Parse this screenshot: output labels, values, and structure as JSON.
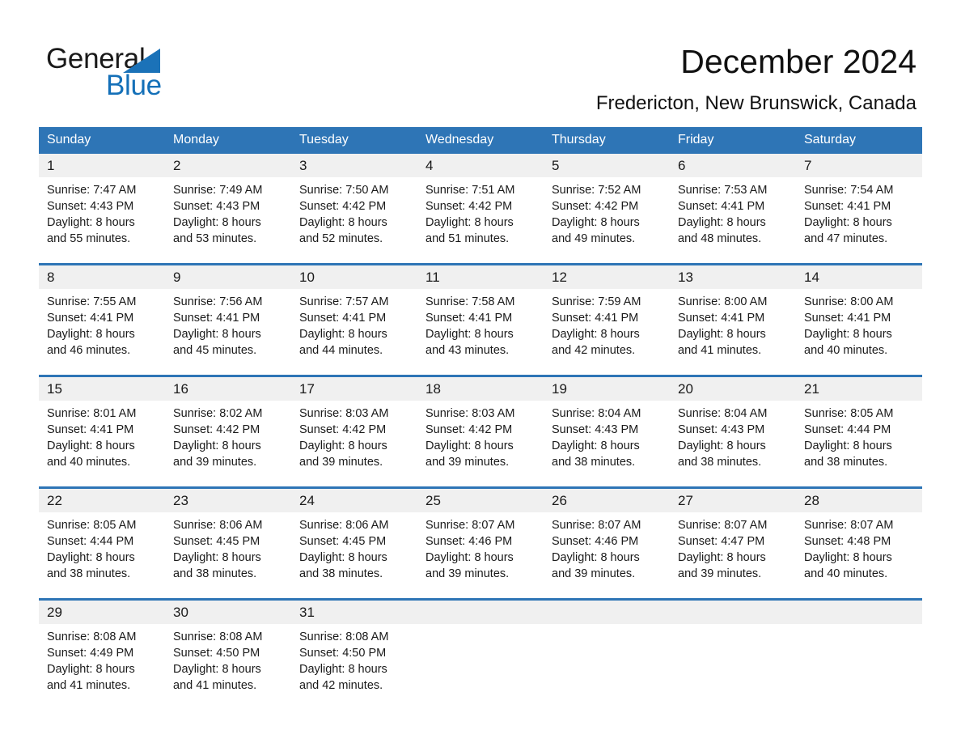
{
  "brand": {
    "name_part1": "General",
    "name_part2": "Blue",
    "triangle_color": "#1b72b8",
    "text_color_part2": "#1470b8"
  },
  "header": {
    "title": "December 2024",
    "subtitle": "Fredericton, New Brunswick, Canada"
  },
  "theme": {
    "header_blue": "#2e75b6",
    "daynum_band": "#f0f0f0",
    "text": "#1a1a1a"
  },
  "calendar": {
    "weekday_headers": [
      "Sunday",
      "Monday",
      "Tuesday",
      "Wednesday",
      "Thursday",
      "Friday",
      "Saturday"
    ],
    "weeks": [
      {
        "days": [
          {
            "num": "1",
            "sunrise": "Sunrise: 7:47 AM",
            "sunset": "Sunset: 4:43 PM",
            "daylight1": "Daylight: 8 hours",
            "daylight2": "and 55 minutes."
          },
          {
            "num": "2",
            "sunrise": "Sunrise: 7:49 AM",
            "sunset": "Sunset: 4:43 PM",
            "daylight1": "Daylight: 8 hours",
            "daylight2": "and 53 minutes."
          },
          {
            "num": "3",
            "sunrise": "Sunrise: 7:50 AM",
            "sunset": "Sunset: 4:42 PM",
            "daylight1": "Daylight: 8 hours",
            "daylight2": "and 52 minutes."
          },
          {
            "num": "4",
            "sunrise": "Sunrise: 7:51 AM",
            "sunset": "Sunset: 4:42 PM",
            "daylight1": "Daylight: 8 hours",
            "daylight2": "and 51 minutes."
          },
          {
            "num": "5",
            "sunrise": "Sunrise: 7:52 AM",
            "sunset": "Sunset: 4:42 PM",
            "daylight1": "Daylight: 8 hours",
            "daylight2": "and 49 minutes."
          },
          {
            "num": "6",
            "sunrise": "Sunrise: 7:53 AM",
            "sunset": "Sunset: 4:41 PM",
            "daylight1": "Daylight: 8 hours",
            "daylight2": "and 48 minutes."
          },
          {
            "num": "7",
            "sunrise": "Sunrise: 7:54 AM",
            "sunset": "Sunset: 4:41 PM",
            "daylight1": "Daylight: 8 hours",
            "daylight2": "and 47 minutes."
          }
        ]
      },
      {
        "days": [
          {
            "num": "8",
            "sunrise": "Sunrise: 7:55 AM",
            "sunset": "Sunset: 4:41 PM",
            "daylight1": "Daylight: 8 hours",
            "daylight2": "and 46 minutes."
          },
          {
            "num": "9",
            "sunrise": "Sunrise: 7:56 AM",
            "sunset": "Sunset: 4:41 PM",
            "daylight1": "Daylight: 8 hours",
            "daylight2": "and 45 minutes."
          },
          {
            "num": "10",
            "sunrise": "Sunrise: 7:57 AM",
            "sunset": "Sunset: 4:41 PM",
            "daylight1": "Daylight: 8 hours",
            "daylight2": "and 44 minutes."
          },
          {
            "num": "11",
            "sunrise": "Sunrise: 7:58 AM",
            "sunset": "Sunset: 4:41 PM",
            "daylight1": "Daylight: 8 hours",
            "daylight2": "and 43 minutes."
          },
          {
            "num": "12",
            "sunrise": "Sunrise: 7:59 AM",
            "sunset": "Sunset: 4:41 PM",
            "daylight1": "Daylight: 8 hours",
            "daylight2": "and 42 minutes."
          },
          {
            "num": "13",
            "sunrise": "Sunrise: 8:00 AM",
            "sunset": "Sunset: 4:41 PM",
            "daylight1": "Daylight: 8 hours",
            "daylight2": "and 41 minutes."
          },
          {
            "num": "14",
            "sunrise": "Sunrise: 8:00 AM",
            "sunset": "Sunset: 4:41 PM",
            "daylight1": "Daylight: 8 hours",
            "daylight2": "and 40 minutes."
          }
        ]
      },
      {
        "days": [
          {
            "num": "15",
            "sunrise": "Sunrise: 8:01 AM",
            "sunset": "Sunset: 4:41 PM",
            "daylight1": "Daylight: 8 hours",
            "daylight2": "and 40 minutes."
          },
          {
            "num": "16",
            "sunrise": "Sunrise: 8:02 AM",
            "sunset": "Sunset: 4:42 PM",
            "daylight1": "Daylight: 8 hours",
            "daylight2": "and 39 minutes."
          },
          {
            "num": "17",
            "sunrise": "Sunrise: 8:03 AM",
            "sunset": "Sunset: 4:42 PM",
            "daylight1": "Daylight: 8 hours",
            "daylight2": "and 39 minutes."
          },
          {
            "num": "18",
            "sunrise": "Sunrise: 8:03 AM",
            "sunset": "Sunset: 4:42 PM",
            "daylight1": "Daylight: 8 hours",
            "daylight2": "and 39 minutes."
          },
          {
            "num": "19",
            "sunrise": "Sunrise: 8:04 AM",
            "sunset": "Sunset: 4:43 PM",
            "daylight1": "Daylight: 8 hours",
            "daylight2": "and 38 minutes."
          },
          {
            "num": "20",
            "sunrise": "Sunrise: 8:04 AM",
            "sunset": "Sunset: 4:43 PM",
            "daylight1": "Daylight: 8 hours",
            "daylight2": "and 38 minutes."
          },
          {
            "num": "21",
            "sunrise": "Sunrise: 8:05 AM",
            "sunset": "Sunset: 4:44 PM",
            "daylight1": "Daylight: 8 hours",
            "daylight2": "and 38 minutes."
          }
        ]
      },
      {
        "days": [
          {
            "num": "22",
            "sunrise": "Sunrise: 8:05 AM",
            "sunset": "Sunset: 4:44 PM",
            "daylight1": "Daylight: 8 hours",
            "daylight2": "and 38 minutes."
          },
          {
            "num": "23",
            "sunrise": "Sunrise: 8:06 AM",
            "sunset": "Sunset: 4:45 PM",
            "daylight1": "Daylight: 8 hours",
            "daylight2": "and 38 minutes."
          },
          {
            "num": "24",
            "sunrise": "Sunrise: 8:06 AM",
            "sunset": "Sunset: 4:45 PM",
            "daylight1": "Daylight: 8 hours",
            "daylight2": "and 38 minutes."
          },
          {
            "num": "25",
            "sunrise": "Sunrise: 8:07 AM",
            "sunset": "Sunset: 4:46 PM",
            "daylight1": "Daylight: 8 hours",
            "daylight2": "and 39 minutes."
          },
          {
            "num": "26",
            "sunrise": "Sunrise: 8:07 AM",
            "sunset": "Sunset: 4:46 PM",
            "daylight1": "Daylight: 8 hours",
            "daylight2": "and 39 minutes."
          },
          {
            "num": "27",
            "sunrise": "Sunrise: 8:07 AM",
            "sunset": "Sunset: 4:47 PM",
            "daylight1": "Daylight: 8 hours",
            "daylight2": "and 39 minutes."
          },
          {
            "num": "28",
            "sunrise": "Sunrise: 8:07 AM",
            "sunset": "Sunset: 4:48 PM",
            "daylight1": "Daylight: 8 hours",
            "daylight2": "and 40 minutes."
          }
        ]
      },
      {
        "days": [
          {
            "num": "29",
            "sunrise": "Sunrise: 8:08 AM",
            "sunset": "Sunset: 4:49 PM",
            "daylight1": "Daylight: 8 hours",
            "daylight2": "and 41 minutes."
          },
          {
            "num": "30",
            "sunrise": "Sunrise: 8:08 AM",
            "sunset": "Sunset: 4:50 PM",
            "daylight1": "Daylight: 8 hours",
            "daylight2": "and 41 minutes."
          },
          {
            "num": "31",
            "sunrise": "Sunrise: 8:08 AM",
            "sunset": "Sunset: 4:50 PM",
            "daylight1": "Daylight: 8 hours",
            "daylight2": "and 42 minutes."
          },
          {
            "num": "",
            "sunrise": "",
            "sunset": "",
            "daylight1": "",
            "daylight2": ""
          },
          {
            "num": "",
            "sunrise": "",
            "sunset": "",
            "daylight1": "",
            "daylight2": ""
          },
          {
            "num": "",
            "sunrise": "",
            "sunset": "",
            "daylight1": "",
            "daylight2": ""
          },
          {
            "num": "",
            "sunrise": "",
            "sunset": "",
            "daylight1": "",
            "daylight2": ""
          }
        ]
      }
    ]
  }
}
